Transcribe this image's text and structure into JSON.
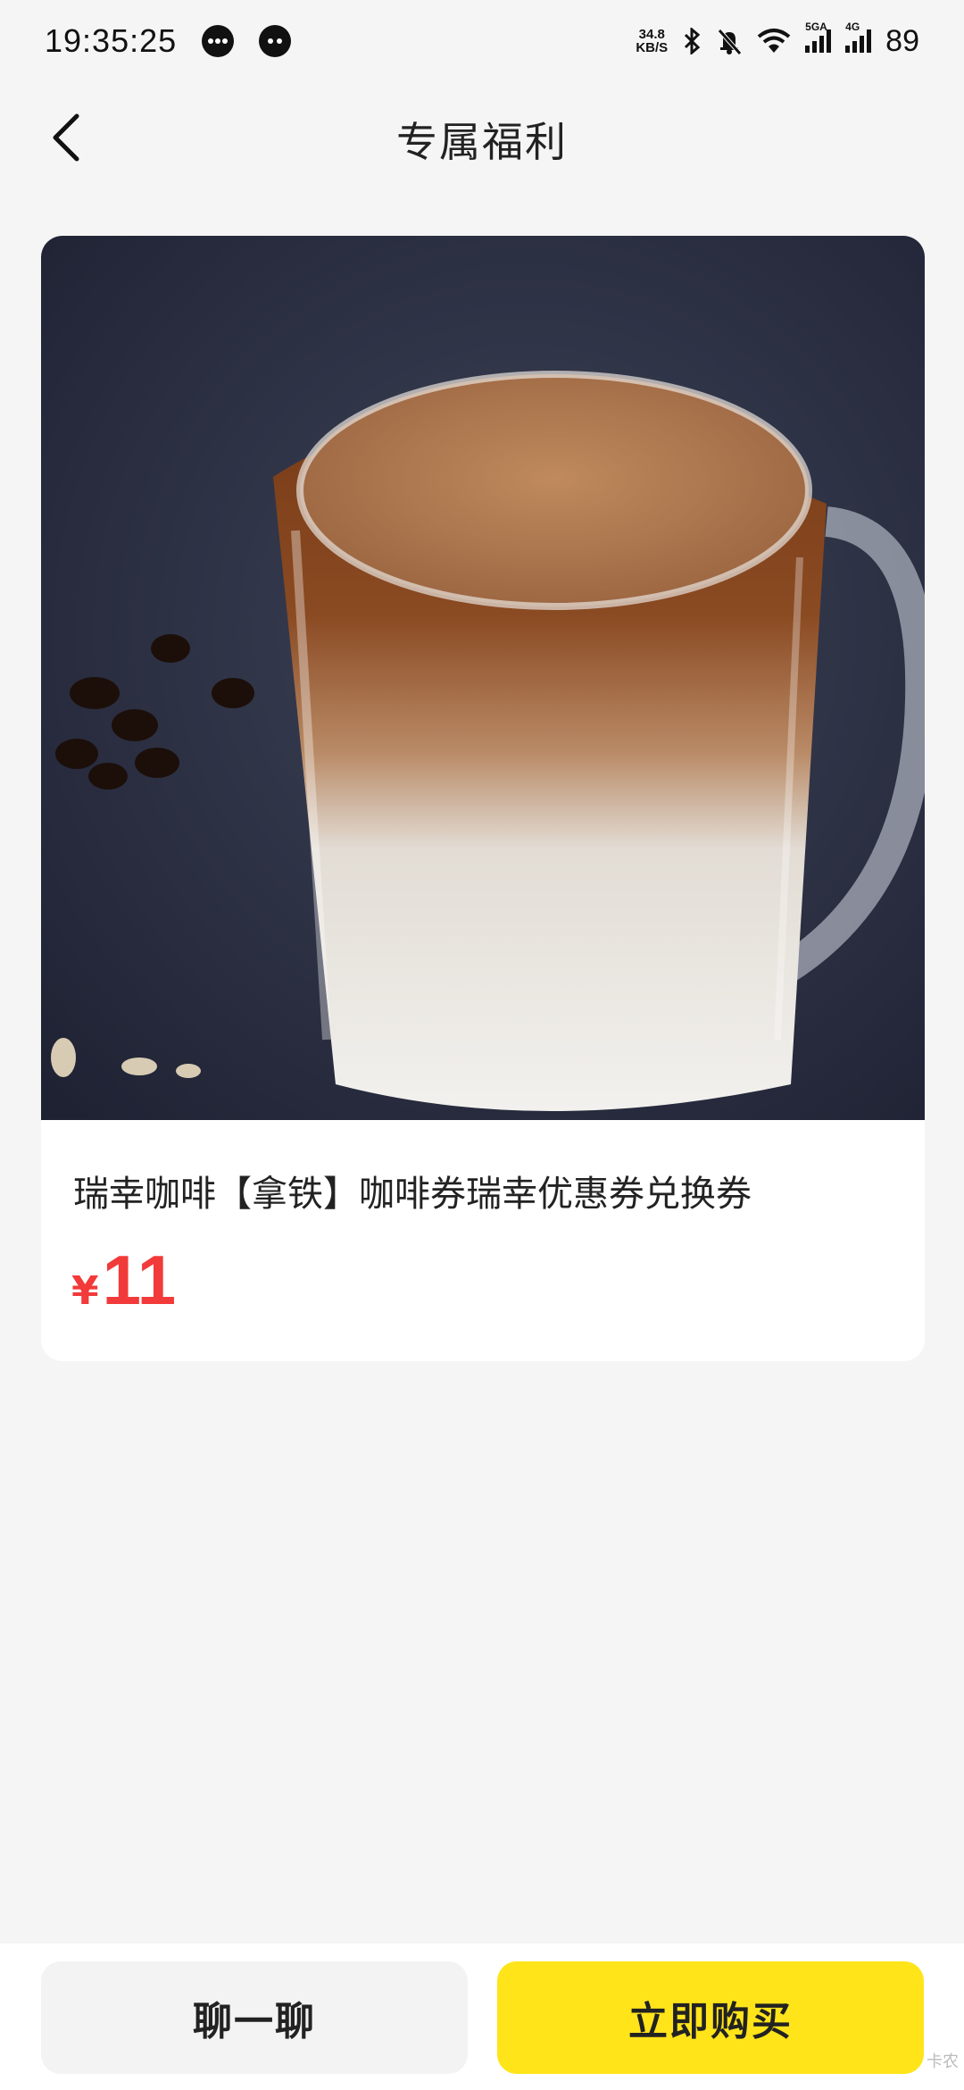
{
  "status_bar": {
    "time": "19:35:25",
    "net_speed_value": "34.8",
    "net_speed_unit": "KB/S",
    "sig1_tag": "5GA",
    "sig2_tag": "4G",
    "battery": "89",
    "icons": [
      "chat-bubble-icon",
      "wechat-icon",
      "bluetooth-icon",
      "mute-bell-icon",
      "wifi-icon",
      "signal-icon",
      "signal-icon"
    ]
  },
  "header": {
    "title": "专属福利"
  },
  "product": {
    "name": "瑞幸咖啡【拿铁】咖啡券瑞幸优惠券兑换券",
    "currency": "¥",
    "price": "11",
    "image": "latte-glass-mug-photo"
  },
  "actions": {
    "chat_label": "聊一聊",
    "buy_label": "立即购买"
  },
  "watermark": "卡农",
  "colors": {
    "price": "#f23a3a",
    "buy_button": "#ffe41a",
    "background": "#f5f5f5"
  }
}
